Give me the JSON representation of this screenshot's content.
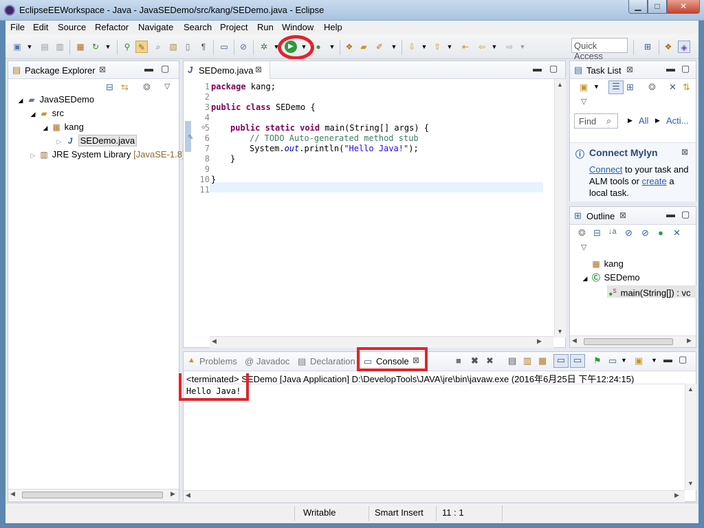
{
  "window": {
    "title": "EclipseEEWorkspace - Java - JavaSEDemo/src/kang/SEDemo.java - Eclipse"
  },
  "menu": [
    "File",
    "Edit",
    "Source",
    "Refactor",
    "Navigate",
    "Search",
    "Project",
    "Run",
    "Window",
    "Help"
  ],
  "toolbar": {
    "quick_access": "Quick Access"
  },
  "package_explorer": {
    "title": "Package Explorer",
    "tree": {
      "project": "JavaSEDemo",
      "src": "src",
      "package": "kang",
      "file": "SEDemo.java",
      "jre": "JRE System Library",
      "jre_version": "[JavaSE-1.8]"
    }
  },
  "editor": {
    "tab": "SEDemo.java",
    "line_numbers": [
      "1",
      "2",
      "3",
      "4",
      "5",
      "6",
      "7",
      "8",
      "9",
      "10",
      "11"
    ],
    "code": {
      "l1_kw": "package",
      "l1_rest": " kang;",
      "l3_kw": "public class",
      "l3_rest": " SEDemo {",
      "l5_kw": "public static void",
      "l5_rest": " main(String[] args) {",
      "l6": "// TODO Auto-generated method stub",
      "l7_a": "System.",
      "l7_out": "out",
      "l7_b": ".println(",
      "l7_str": "\"Hello Java!\"",
      "l7_c": ");",
      "l8": "}",
      "l10": "}"
    }
  },
  "task_list": {
    "title": "Task List",
    "find_placeholder": "Find",
    "all": "All",
    "activate": "Acti...",
    "mylyn_title": "Connect Mylyn",
    "mylyn_link_connect": "Connect",
    "mylyn_text_1": " to your task and ALM tools or ",
    "mylyn_link_create": "create",
    "mylyn_text_2": " a local task."
  },
  "outline": {
    "title": "Outline",
    "items": {
      "package": "kang",
      "class": "SEDemo",
      "method": "main(String[]) : vc"
    }
  },
  "bottom_tabs": {
    "problems": "Problems",
    "javadoc": "Javadoc",
    "declaration": "Declaration",
    "console": "Console"
  },
  "console": {
    "terminated_prefix": "<terminated>",
    "header_rest": " SEDemo [Java Application] D:\\DevelopTools\\JAVA\\jre\\bin\\javaw.exe (2016年6月25日 下午12:24:15)",
    "output": "Hello Java!"
  },
  "status": {
    "writable": "Writable",
    "insert": "Smart Insert",
    "position": "11 : 1"
  },
  "colors": {
    "highlight": "#e0242c",
    "keyword": "#7f0055",
    "comment": "#3f7f5f",
    "string": "#2a00ff"
  }
}
